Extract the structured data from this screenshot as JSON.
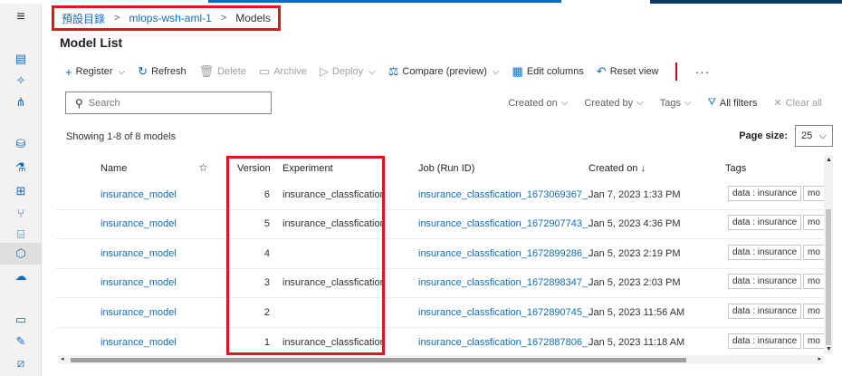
{
  "topbar": {
    "right_text": "mlops-wsh-aml-1"
  },
  "rail": {
    "icons": [
      "menu-icon",
      "document-icon",
      "sparkle-icon",
      "pipeline-icon",
      "data-icon",
      "flask-icon",
      "components-icon",
      "branch-icon",
      "compute-icon",
      "model-icon",
      "endpoint-icon",
      "monitor-icon",
      "wrench-icon",
      "edit-icon"
    ]
  },
  "breadcrumb": {
    "root": "預設目錄",
    "workspace": "mlops-wsh-aml-1",
    "current": "Models",
    "sep": ">"
  },
  "page": {
    "title": "Model List"
  },
  "toolbar": {
    "register": "Register",
    "refresh": "Refresh",
    "delete": "Delete",
    "archive": "Archive",
    "deploy": "Deploy",
    "compare": "Compare (preview)",
    "edit_columns": "Edit columns",
    "reset_view": "Reset view",
    "more": "···"
  },
  "search": {
    "placeholder": "Search"
  },
  "filters": {
    "created_on": "Created on",
    "created_by": "Created by",
    "tags": "Tags",
    "all_filters": "All filters",
    "clear_all": "Clear all"
  },
  "summary": {
    "showing": "Showing 1-8 of 8 models"
  },
  "pagesize": {
    "label": "Page size:",
    "value": "25"
  },
  "columns": {
    "name": "Name",
    "version": "Version",
    "experiment": "Experiment",
    "job": "Job (Run ID)",
    "created_on": "Created on ↓",
    "tags": "Tags"
  },
  "rows": [
    {
      "name": "insurance_model",
      "version": "6",
      "experiment": "insurance_classfication",
      "job": "insurance_classfication_1673069367_...",
      "created": "Jan 7, 2023 1:33 PM",
      "tag": "data : insurance",
      "tag2": "mo"
    },
    {
      "name": "insurance_model",
      "version": "5",
      "experiment": "insurance_classfication",
      "job": "insurance_classfication_1672907743_...",
      "created": "Jan 5, 2023 4:36 PM",
      "tag": "data : insurance",
      "tag2": "mo"
    },
    {
      "name": "insurance_model",
      "version": "4",
      "experiment": "",
      "job": "insurance_classfication_1672899286_...",
      "created": "Jan 5, 2023 2:19 PM",
      "tag": "data : insurance",
      "tag2": "mo"
    },
    {
      "name": "insurance_model",
      "version": "3",
      "experiment": "insurance_classfication",
      "job": "insurance_classfication_1672898347_...",
      "created": "Jan 5, 2023 2:03 PM",
      "tag": "data : insurance",
      "tag2": "mo"
    },
    {
      "name": "insurance_model",
      "version": "2",
      "experiment": "",
      "job": "insurance_classfication_1672890745_...",
      "created": "Jan 5, 2023 11:56 AM",
      "tag": "data : insurance",
      "tag2": "mo"
    },
    {
      "name": "insurance_model",
      "version": "1",
      "experiment": "insurance_classfication",
      "job": "insurance_classfication_1672887806_...",
      "created": "Jan 5, 2023 11:18 AM",
      "tag": "data : insurance",
      "tag2": "mo"
    }
  ]
}
